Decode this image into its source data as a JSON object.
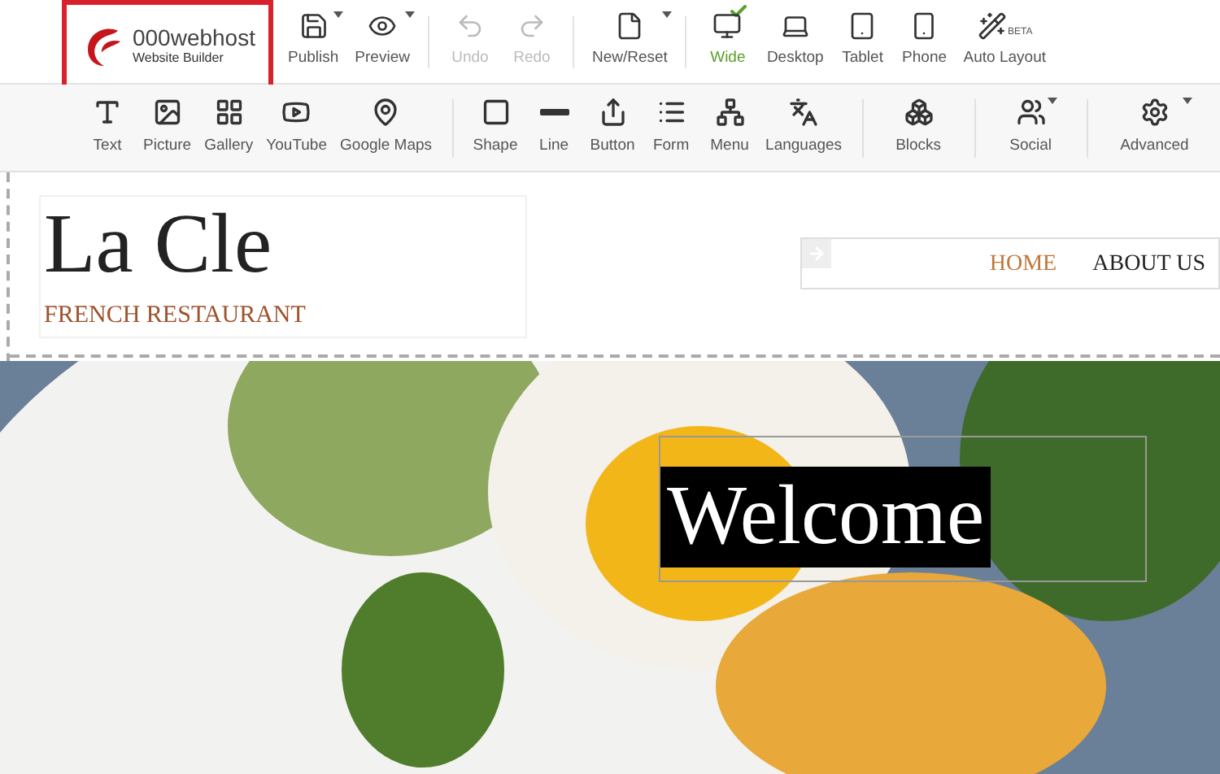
{
  "logo": {
    "name": "000webhost",
    "subtitle": "Website Builder"
  },
  "top_toolbar": [
    {
      "kind": "action",
      "label": "Publish",
      "disabled": false,
      "dropdown": true
    },
    {
      "kind": "action",
      "label": "Preview",
      "disabled": false,
      "dropdown": true
    },
    {
      "kind": "action",
      "label": "Undo",
      "disabled": true,
      "dropdown": false
    },
    {
      "kind": "action",
      "label": "Redo",
      "disabled": true,
      "dropdown": false
    },
    {
      "kind": "action",
      "label": "New/Reset",
      "disabled": false,
      "dropdown": true
    },
    {
      "kind": "view",
      "label": "Wide",
      "selected": true
    },
    {
      "kind": "view",
      "label": "Desktop",
      "selected": false
    },
    {
      "kind": "view",
      "label": "Tablet",
      "selected": false
    },
    {
      "kind": "view",
      "label": "Phone",
      "selected": false
    },
    {
      "kind": "auto",
      "label": "Auto Layout",
      "badge": "BETA"
    }
  ],
  "insert_toolbar": [
    [
      {
        "label": "Text",
        "dropdown": false
      },
      {
        "label": "Picture",
        "dropdown": false
      },
      {
        "label": "Gallery",
        "dropdown": false
      },
      {
        "label": "YouTube",
        "dropdown": false
      },
      {
        "label": "Google Maps",
        "dropdown": false
      }
    ],
    [
      {
        "label": "Shape",
        "dropdown": false
      },
      {
        "label": "Line",
        "dropdown": false
      },
      {
        "label": "Button",
        "dropdown": false
      },
      {
        "label": "Form",
        "dropdown": false
      },
      {
        "label": "Menu",
        "dropdown": false
      },
      {
        "label": "Languages",
        "dropdown": false
      }
    ],
    [
      {
        "label": "Blocks",
        "dropdown": false
      }
    ],
    [
      {
        "label": "Social",
        "dropdown": true
      }
    ],
    [
      {
        "label": "Advanced",
        "dropdown": true
      }
    ]
  ],
  "site": {
    "title": "La Cle",
    "subtitle": "FRENCH RESTAURANT",
    "nav": [
      {
        "label": "HOME",
        "selected": true
      },
      {
        "label": "ABOUT US",
        "selected": false
      }
    ],
    "hero": {
      "heading": "Welcome"
    }
  }
}
